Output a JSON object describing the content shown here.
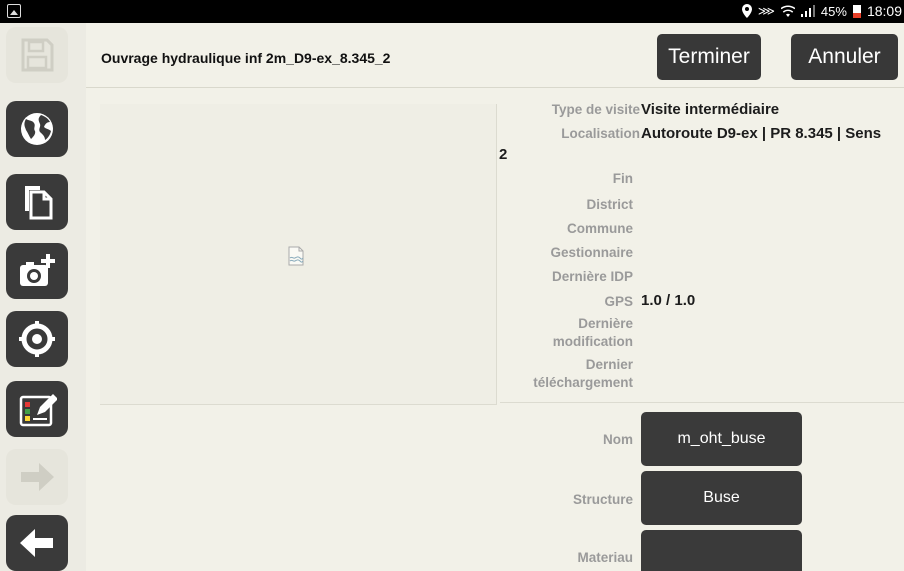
{
  "status_bar": {
    "battery": "45%",
    "time": "18:09",
    "icons": [
      "image-icon",
      "location-icon",
      "mute-icon",
      "wifi-icon",
      "signal-icon",
      "battery-icon"
    ]
  },
  "sidebar": {
    "items": [
      {
        "name": "save",
        "icon": "save-icon",
        "enabled": false
      },
      {
        "name": "globe",
        "icon": "globe-icon",
        "enabled": true
      },
      {
        "name": "documents",
        "icon": "copy-documents-icon",
        "enabled": true
      },
      {
        "name": "add-photo",
        "icon": "camera-add-icon",
        "enabled": true
      },
      {
        "name": "locate",
        "icon": "target-icon",
        "enabled": true
      },
      {
        "name": "edit-form",
        "icon": "edit-checklist-icon",
        "enabled": true
      },
      {
        "name": "next",
        "icon": "arrow-right-icon",
        "enabled": false
      },
      {
        "name": "back",
        "icon": "arrow-left-icon",
        "enabled": true
      }
    ]
  },
  "header": {
    "title": "Ouvrage hydraulique inf 2m_D9-ex_8.345_2",
    "finish_label": "Terminer",
    "cancel_label": "Annuler"
  },
  "photo": {
    "icon": "broken-image-icon"
  },
  "info": {
    "type_visite_label": "Type de visite",
    "type_visite_value": "Visite intermédiaire",
    "localisation_label": "Localisation",
    "localisation_value": "Autoroute D9-ex | PR 8.345 | Sens",
    "localisation_value_cont": "2",
    "fin_label": "Fin",
    "district_label": "District",
    "commune_label": "Commune",
    "gestionnaire_label": "Gestionnaire",
    "derniere_idp_label": "Dernière IDP",
    "gps_label": "GPS",
    "gps_value": "1.0 / 1.0",
    "derniere_modif_label_1": "Dernière",
    "derniere_modif_label_2": "modification",
    "dernier_tele_label_1": "Dernier",
    "dernier_tele_label_2": "téléchargement"
  },
  "fields": {
    "nom_label": "Nom",
    "nom_value": "m_oht_buse",
    "structure_label": "Structure",
    "structure_value": "Buse",
    "materiau_label": "Materiau",
    "materiau_value": ""
  },
  "colors": {
    "background": "#f2f1e8",
    "button_dark": "#383838",
    "label_gray": "#9a9a9a"
  }
}
